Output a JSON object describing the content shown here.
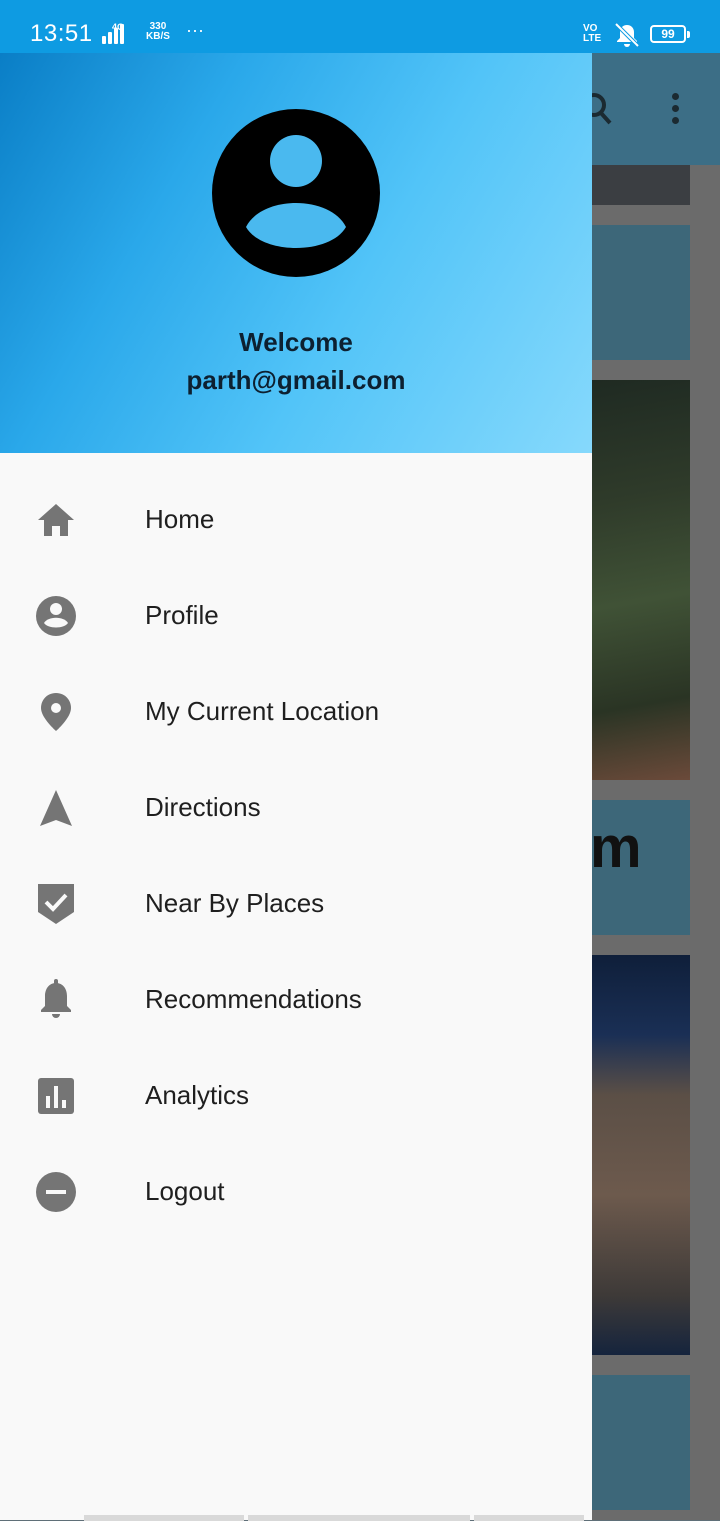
{
  "status_bar": {
    "time": "13:51",
    "network_type": "4G",
    "speed_value": "330",
    "speed_unit": "KB/S",
    "more": "···",
    "volte": "VO",
    "volte_sub": "LTE",
    "battery": "99"
  },
  "background_app": {
    "card_text_fragment": "m"
  },
  "drawer": {
    "header": {
      "welcome": "Welcome",
      "email": "parth@gmail.com"
    },
    "items": [
      {
        "label": "Home",
        "icon": "home-icon"
      },
      {
        "label": "Profile",
        "icon": "account-circle-icon"
      },
      {
        "label": "My Current Location",
        "icon": "location-pin-icon"
      },
      {
        "label": "Directions",
        "icon": "navigation-arrow-icon"
      },
      {
        "label": "Near By Places",
        "icon": "verified-shield-icon"
      },
      {
        "label": "Recommendations",
        "icon": "bell-icon"
      },
      {
        "label": "Analytics",
        "icon": "bar-chart-icon"
      },
      {
        "label": "Logout",
        "icon": "minus-circle-icon"
      }
    ]
  },
  "colors": {
    "status_bar": "#0e9be2",
    "header_gradient_start": "#0a7ec6",
    "header_gradient_end": "#86d9fc",
    "icon": "#757575",
    "text": "#1f1f1f"
  }
}
